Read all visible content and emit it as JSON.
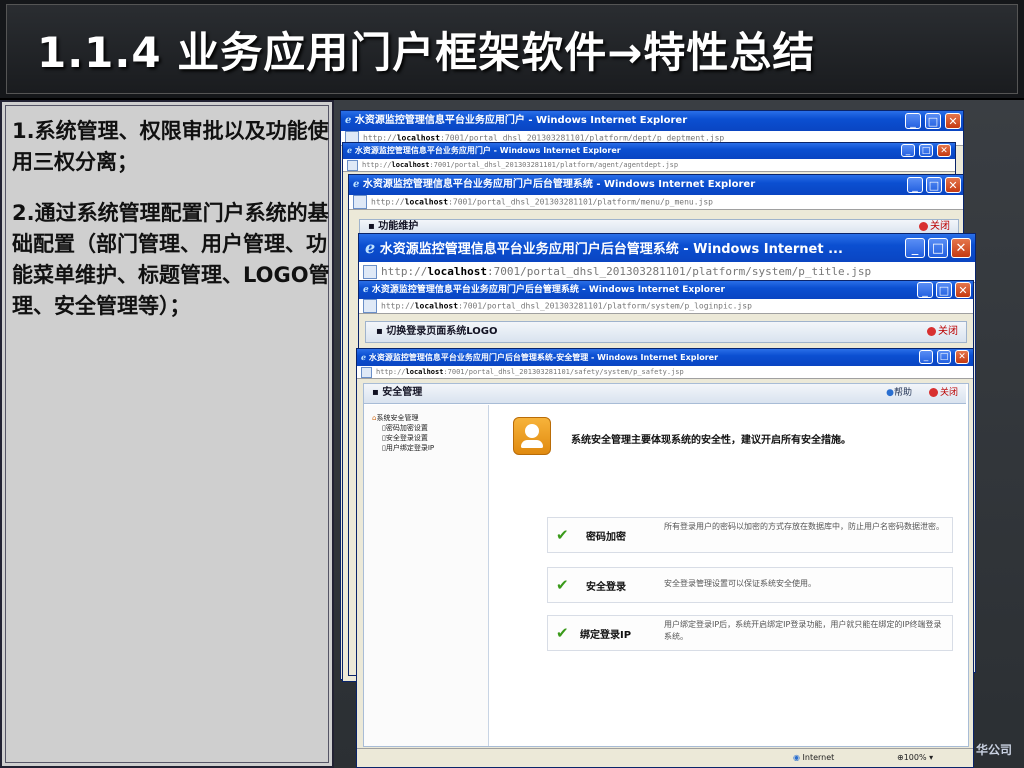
{
  "slide": {
    "title": "1.1.4 业务应用门户框架软件→特性总结",
    "points": [
      "1.系统管理、权限审批以及功能使用三权分离；",
      "2.通过系统管理配置门户系统的基础配置（部门管理、用户管理、功能菜单维护、标题管理、LOGO管理、安全管理等）；"
    ],
    "brand_fragment": "华公司"
  },
  "windows": [
    {
      "title": "水资源监控管理信息平台业务应用门户 - Windows Internet Explorer",
      "addr_prefix": "http://",
      "addr_host": "localhost",
      "addr_path": ":7001/portal_dhsl_201303281101/platform/dept/p_deptment.jsp"
    },
    {
      "title": "水资源监控管理信息平台业务应用门户 - Windows Internet Explorer",
      "addr_prefix": "http://",
      "addr_host": "localhost",
      "addr_path": ":7001/portal_dhsl_201303281101/platform/agent/agentdept.jsp"
    },
    {
      "title": "水资源监控管理信息平台业务应用门户后台管理系统 - Windows Internet Explorer",
      "addr_prefix": "http://",
      "addr_host": "localhost",
      "addr_path": ":7001/portal_dhsl_201303281101/platform/menu/p_menu.jsp",
      "panel_title": "功能维护",
      "close_label": "关闭"
    },
    {
      "title": "水资源监控管理信息平台业务应用门户后台管理系统 - Windows Internet ...",
      "addr_prefix": "http://",
      "addr_host": "localhost",
      "addr_path": ":7001/portal_dhsl_201303281101/platform/system/p_title.jsp"
    },
    {
      "title": "水资源监控管理信息平台业务应用门户后台管理系统 - Windows Internet Explorer",
      "addr_prefix": "http://",
      "addr_host": "localhost",
      "addr_path": ":7001/portal_dhsl_201303281101/platform/system/p_loginpic.jsp",
      "panel_title": "切换登录页面系统LOGO",
      "close_label": "关闭"
    },
    {
      "title": "水资源监控管理信息平台业务应用门户后台管理系统-安全管理 - Windows Internet Explorer",
      "addr_prefix": "http://",
      "addr_host": "localhost",
      "addr_path": ":7001/portal_dhsl_201303281101/safety/system/p_safety.jsp",
      "panel_title": "安全管理",
      "help_label": "帮助",
      "close_label": "关闭"
    }
  ],
  "security": {
    "tree": {
      "root": "系统安全管理",
      "children": [
        "密码加密设置",
        "安全登录设置",
        "用户绑定登录IP"
      ]
    },
    "headline": "系统安全管理主要体现系统的安全性，建议开启所有安全措施。",
    "items": [
      {
        "label": "密码加密",
        "desc": "所有登录用户的密码以加密的方式存放在数据库中，防止用户名密码数据泄密。"
      },
      {
        "label": "安全登录",
        "desc": "安全登录管理设置可以保证系统安全使用。"
      },
      {
        "label": "绑定登录IP",
        "desc": "用户绑定登录IP后，系统开启绑定IP登录功能，用户就只能在绑定的IP终端登录系统。"
      }
    ]
  },
  "statusbar": {
    "zone": "Internet",
    "zoom": "100%"
  },
  "colors": {
    "titlebar": "#0b4fd1",
    "slide_bg": "#2c3034",
    "check": "#3a9a1a"
  }
}
